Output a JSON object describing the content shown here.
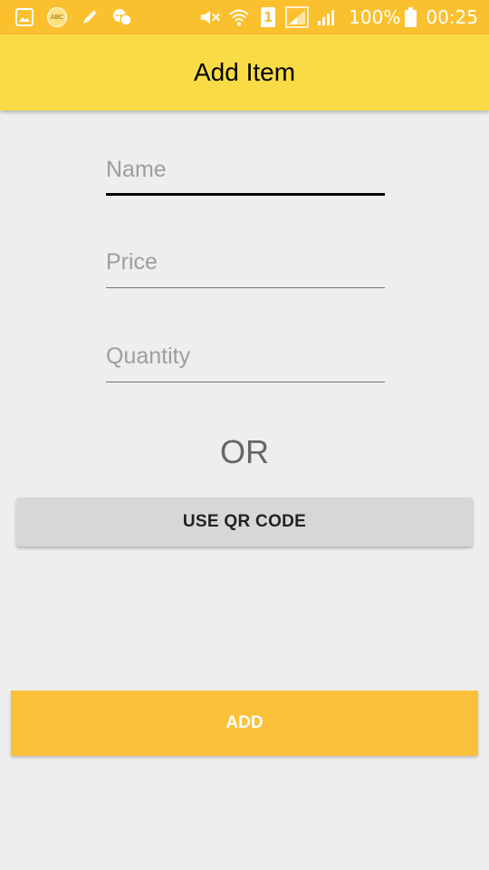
{
  "status_bar": {
    "battery_percent": "100%",
    "time": "00:25",
    "sim_slot": "1",
    "abc_badge": "ABC",
    "color": "#fbc02d",
    "left_icons": [
      "gallery-icon",
      "abc-badge-icon",
      "pen-icon",
      "chat-icon"
    ],
    "right_icons": [
      "mute-icon",
      "wifi-icon",
      "sim-icon",
      "signal-icon",
      "signal-icon",
      "battery-icon"
    ]
  },
  "app_bar": {
    "title": "Add Item",
    "color": "#f9dc45"
  },
  "form": {
    "name_placeholder": "Name",
    "price_placeholder": "Price",
    "quantity_placeholder": "Quantity",
    "or_label": "OR",
    "qr_button_label": "USE QR CODE"
  },
  "add_button": {
    "label": "ADD",
    "color": "#fbc13a"
  }
}
